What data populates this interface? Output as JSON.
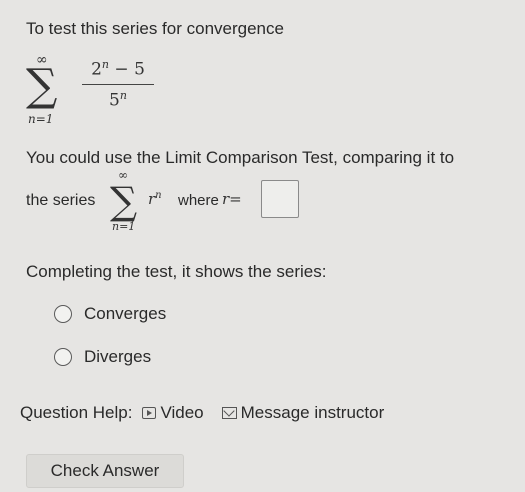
{
  "prompt": "To test this series for convergence",
  "series": {
    "sigma": "∑",
    "upper": "∞",
    "lower": "n=1",
    "numerator_base": "2",
    "numerator_exp": "n",
    "numerator_tail": " − 5",
    "denominator_base": "5",
    "denominator_exp": "n"
  },
  "lct_text": "You could use the Limit Comparison Test, comparing it to",
  "comparison": {
    "prefix": "the series",
    "sigma": "∑",
    "upper": "∞",
    "lower": "n=1",
    "term_base": "r",
    "term_exp": "n",
    "where": "where",
    "var": "r="
  },
  "answer_box_value": "",
  "completing": "Completing the test, it shows the series:",
  "options": [
    "Converges",
    "Diverges"
  ],
  "help": {
    "label": "Question Help:",
    "video": "Video",
    "message": "Message instructor"
  },
  "check_answer": "Check Answer"
}
